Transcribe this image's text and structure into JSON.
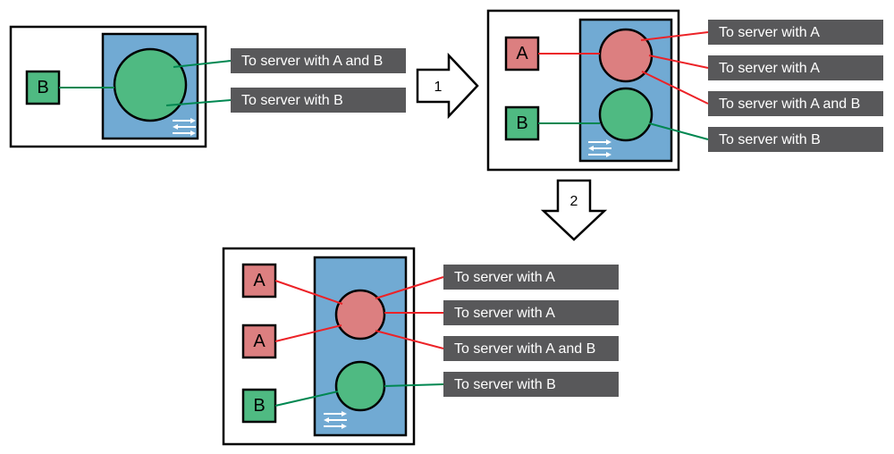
{
  "panel1": {
    "appB": "B",
    "labels": [
      "To server with A and B",
      "To server with B"
    ]
  },
  "panel2": {
    "appA": "A",
    "appB": "B",
    "labels": [
      "To server with A",
      "To server with A",
      "To server with A and B",
      "To server with B"
    ]
  },
  "panel3": {
    "appA1": "A",
    "appA2": "A",
    "appB": "B",
    "labels": [
      "To server with A",
      "To server with A",
      "To server with A and B",
      "To server with B"
    ]
  },
  "arrows": {
    "step1": "1",
    "step2": "2"
  }
}
